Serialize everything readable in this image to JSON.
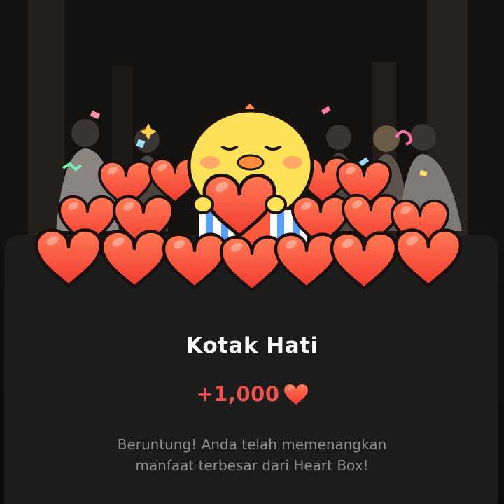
{
  "reward": {
    "title": "Kotak Hati",
    "amount": "+1,000",
    "message_line1": "Beruntung! Anda telah memenangkan",
    "message_line2": "manfaat terbesar dari Heart Box!",
    "currency_icon": "heart-icon"
  },
  "colors": {
    "sheet_bg": "#1c1c1c",
    "amount": "#f0524f",
    "heart": "#ff5a3c",
    "message": "#8f8f8f"
  }
}
